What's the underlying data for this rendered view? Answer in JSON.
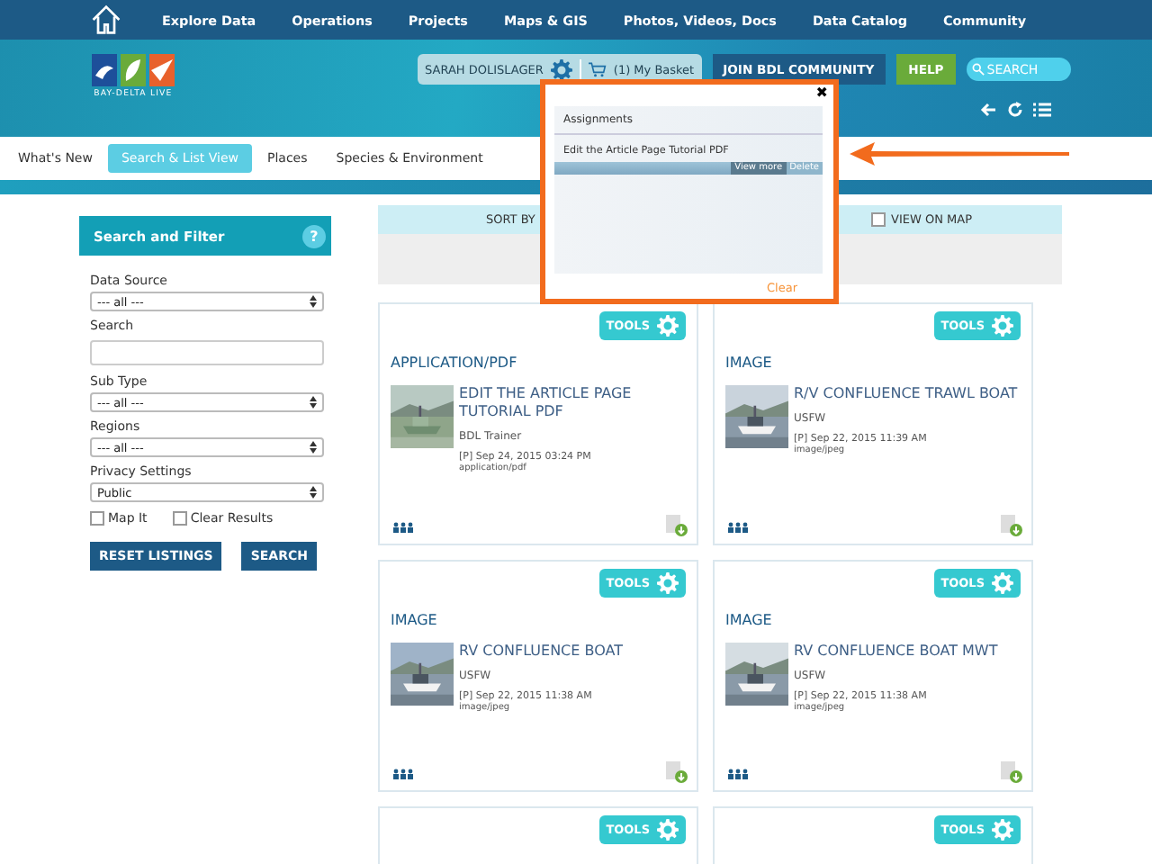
{
  "nav": {
    "items": [
      "Explore Data",
      "Operations",
      "Projects",
      "Maps & GIS",
      "Photos, Videos, Docs",
      "Data Catalog",
      "Community"
    ]
  },
  "header": {
    "logo_text": "BAY-DELTA LIVE",
    "user": "SARAH DOLISLAGER",
    "basket": "(1) My Basket",
    "join_button": "JOIN BDL COMMUNITY",
    "help_button": "HELP",
    "search": {
      "placeholder": "SEARCH"
    }
  },
  "tabs": [
    {
      "label": "What's New",
      "selected": false
    },
    {
      "label": "Search & List View",
      "selected": true
    },
    {
      "label": "Places",
      "selected": false
    },
    {
      "label": "Species & Environment",
      "selected": false
    }
  ],
  "sidebar": {
    "title": "Search and Filter",
    "help": "?",
    "fields": [
      {
        "kind": "select",
        "label": "Data Source",
        "value": "--- all ---"
      },
      {
        "kind": "text",
        "label": "Search"
      },
      {
        "kind": "select",
        "label": "Sub Type",
        "value": "--- all ---"
      },
      {
        "kind": "select",
        "label": "Regions",
        "value": "--- all ---"
      },
      {
        "kind": "select",
        "label": "Privacy Settings",
        "value": "Public"
      }
    ],
    "checkboxes": [
      {
        "label": "Map It",
        "checked": false
      },
      {
        "label": "Clear Results",
        "checked": false
      }
    ],
    "buttons": [
      "RESET LISTINGS",
      "SEARCH"
    ]
  },
  "toolbar": {
    "sort_label": "SORT BY",
    "view_on_map": {
      "label": "VIEW ON MAP",
      "checked": false
    }
  },
  "cards": [
    {
      "tools": "TOOLS",
      "type": "APPLICATION/PDF",
      "title": "EDIT THE ARTICLE PAGE TUTORIAL PDF",
      "author": "BDL Trainer",
      "date": "[P] Sep 24, 2015 03:24 PM",
      "mime": "application/pdf"
    },
    {
      "tools": "TOOLS",
      "type": "IMAGE",
      "title": "R/V CONFLUENCE TRAWL BOAT",
      "author": "USFW",
      "date": "[P] Sep 22, 2015 11:39 AM",
      "mime": "image/jpeg"
    },
    {
      "tools": "TOOLS",
      "type": "IMAGE",
      "title": "RV CONFLUENCE BOAT",
      "author": "USFW",
      "date": "[P] Sep 22, 2015 11:38 AM",
      "mime": "image/jpeg"
    },
    {
      "tools": "TOOLS",
      "type": "IMAGE",
      "title": "RV CONFLUENCE BOAT MWT",
      "author": "USFW",
      "date": "[P] Sep 22, 2015 11:38 AM",
      "mime": "image/jpeg"
    },
    {
      "tools": "TOOLS"
    },
    {
      "tools": "TOOLS"
    }
  ],
  "popup": {
    "close": "✖",
    "title": "Assignments",
    "items": [
      {
        "text": "Edit the Article Page Tutorial PDF",
        "actions": [
          "View more",
          "Delete"
        ]
      }
    ],
    "clear": "Clear"
  }
}
